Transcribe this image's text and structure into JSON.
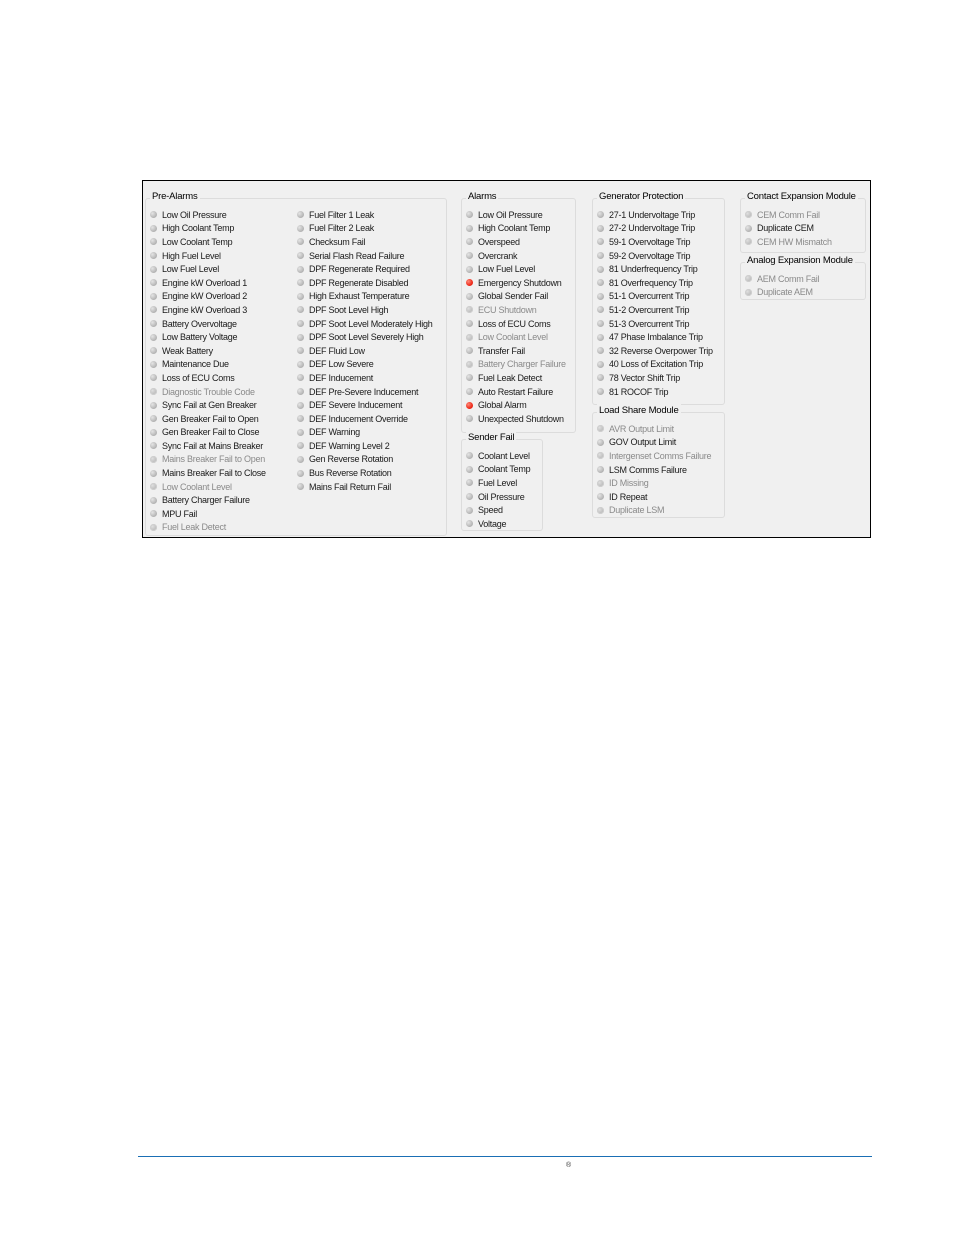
{
  "groups": {
    "pre_alarms": {
      "title": "Pre-Alarms",
      "col1": [
        {
          "label": "Low Oil Pressure",
          "state": "off",
          "enabled": true
        },
        {
          "label": "High Coolant Temp",
          "state": "off",
          "enabled": true
        },
        {
          "label": "Low Coolant Temp",
          "state": "off",
          "enabled": true
        },
        {
          "label": "High Fuel Level",
          "state": "off",
          "enabled": true
        },
        {
          "label": "Low Fuel Level",
          "state": "off",
          "enabled": true
        },
        {
          "label": "Engine kW Overload 1",
          "state": "off",
          "enabled": true
        },
        {
          "label": "Engine kW Overload 2",
          "state": "off",
          "enabled": true
        },
        {
          "label": "Engine kW Overload 3",
          "state": "off",
          "enabled": true
        },
        {
          "label": "Battery Overvoltage",
          "state": "off",
          "enabled": true
        },
        {
          "label": "Low Battery Voltage",
          "state": "off",
          "enabled": true
        },
        {
          "label": "Weak Battery",
          "state": "off",
          "enabled": true
        },
        {
          "label": "Maintenance Due",
          "state": "off",
          "enabled": true
        },
        {
          "label": "Loss of ECU Coms",
          "state": "off",
          "enabled": true
        },
        {
          "label": "Diagnostic Trouble Code",
          "state": "off",
          "enabled": false
        },
        {
          "label": "Sync Fail at Gen Breaker",
          "state": "off",
          "enabled": true
        },
        {
          "label": "Gen Breaker Fail to Open",
          "state": "off",
          "enabled": true
        },
        {
          "label": "Gen Breaker Fail to Close",
          "state": "off",
          "enabled": true
        },
        {
          "label": "Sync Fail at Mains Breaker",
          "state": "off",
          "enabled": true
        },
        {
          "label": "Mains Breaker Fail to Open",
          "state": "off",
          "enabled": false
        },
        {
          "label": "Mains Breaker Fail to Close",
          "state": "off",
          "enabled": true
        },
        {
          "label": "Low Coolant Level",
          "state": "off",
          "enabled": false
        },
        {
          "label": "Battery Charger Failure",
          "state": "off",
          "enabled": true
        },
        {
          "label": "MPU Fail",
          "state": "off",
          "enabled": true
        },
        {
          "label": "Fuel Leak Detect",
          "state": "off",
          "enabled": false
        }
      ],
      "col2": [
        {
          "label": "Fuel Filter 1 Leak",
          "state": "off",
          "enabled": true
        },
        {
          "label": "Fuel Filter 2 Leak",
          "state": "off",
          "enabled": true
        },
        {
          "label": "Checksum Fail",
          "state": "off",
          "enabled": true
        },
        {
          "label": "Serial Flash Read Failure",
          "state": "off",
          "enabled": true
        },
        {
          "label": "DPF Regenerate Required",
          "state": "off",
          "enabled": true
        },
        {
          "label": "DPF Regenerate Disabled",
          "state": "off",
          "enabled": true
        },
        {
          "label": "High Exhaust Temperature",
          "state": "off",
          "enabled": true
        },
        {
          "label": "DPF Soot Level High",
          "state": "off",
          "enabled": true
        },
        {
          "label": "DPF Soot Level Moderately High",
          "state": "off",
          "enabled": true
        },
        {
          "label": "DPF Soot Level Severely High",
          "state": "off",
          "enabled": true
        },
        {
          "label": "DEF Fluid Low",
          "state": "off",
          "enabled": true
        },
        {
          "label": "DEF Low Severe",
          "state": "off",
          "enabled": true
        },
        {
          "label": "DEF Inducement",
          "state": "off",
          "enabled": true
        },
        {
          "label": "DEF Pre-Severe Inducement",
          "state": "off",
          "enabled": true
        },
        {
          "label": "DEF Severe Inducement",
          "state": "off",
          "enabled": true
        },
        {
          "label": "DEF Inducement Override",
          "state": "off",
          "enabled": true
        },
        {
          "label": "DEF Warning",
          "state": "off",
          "enabled": true
        },
        {
          "label": "DEF Warning Level 2",
          "state": "off",
          "enabled": true
        },
        {
          "label": "Gen Reverse Rotation",
          "state": "off",
          "enabled": true
        },
        {
          "label": "Bus Reverse Rotation",
          "state": "off",
          "enabled": true
        },
        {
          "label": "Mains Fail Return Fail",
          "state": "off",
          "enabled": true
        }
      ]
    },
    "alarms": {
      "title": "Alarms",
      "items": [
        {
          "label": "Low Oil Pressure",
          "state": "off",
          "enabled": true
        },
        {
          "label": "High Coolant Temp",
          "state": "off",
          "enabled": true
        },
        {
          "label": "Overspeed",
          "state": "off",
          "enabled": true
        },
        {
          "label": "Overcrank",
          "state": "off",
          "enabled": true
        },
        {
          "label": "Low Fuel Level",
          "state": "off",
          "enabled": true
        },
        {
          "label": "Emergency Shutdown",
          "state": "on",
          "enabled": true
        },
        {
          "label": "Global Sender Fail",
          "state": "off",
          "enabled": true
        },
        {
          "label": "ECU Shutdown",
          "state": "off",
          "enabled": false
        },
        {
          "label": "Loss of ECU Coms",
          "state": "off",
          "enabled": true
        },
        {
          "label": "Low Coolant Level",
          "state": "off",
          "enabled": false
        },
        {
          "label": "Transfer Fail",
          "state": "off",
          "enabled": true
        },
        {
          "label": "Battery Charger Failure",
          "state": "off",
          "enabled": false
        },
        {
          "label": "Fuel Leak Detect",
          "state": "off",
          "enabled": true
        },
        {
          "label": "Auto Restart Failure",
          "state": "off",
          "enabled": true
        },
        {
          "label": "Global Alarm",
          "state": "on",
          "enabled": true
        },
        {
          "label": "Unexpected Shutdown",
          "state": "off",
          "enabled": true
        }
      ]
    },
    "sender_fail": {
      "title": "Sender Fail",
      "items": [
        {
          "label": "Coolant Level",
          "state": "off",
          "enabled": true
        },
        {
          "label": "Coolant Temp",
          "state": "off",
          "enabled": true
        },
        {
          "label": "Fuel Level",
          "state": "off",
          "enabled": true
        },
        {
          "label": "Oil Pressure",
          "state": "off",
          "enabled": true
        },
        {
          "label": "Speed",
          "state": "off",
          "enabled": true
        },
        {
          "label": "Voltage",
          "state": "off",
          "enabled": true
        }
      ]
    },
    "generator_protection": {
      "title": "Generator Protection",
      "items": [
        {
          "label": "27-1 Undervoltage Trip",
          "state": "off",
          "enabled": true
        },
        {
          "label": "27-2 Undervoltage Trip",
          "state": "off",
          "enabled": true
        },
        {
          "label": "59-1 Overvoltage Trip",
          "state": "off",
          "enabled": true
        },
        {
          "label": "59-2 Overvoltage Trip",
          "state": "off",
          "enabled": true
        },
        {
          "label": "81 Underfrequency Trip",
          "state": "off",
          "enabled": true
        },
        {
          "label": "81 Overfrequency Trip",
          "state": "off",
          "enabled": true
        },
        {
          "label": "51-1 Overcurrent Trip",
          "state": "off",
          "enabled": true
        },
        {
          "label": "51-2 Overcurrent Trip",
          "state": "off",
          "enabled": true
        },
        {
          "label": "51-3 Overcurrent Trip",
          "state": "off",
          "enabled": true
        },
        {
          "label": "47 Phase Imbalance Trip",
          "state": "off",
          "enabled": true
        },
        {
          "label": "32 Reverse Overpower Trip",
          "state": "off",
          "enabled": true
        },
        {
          "label": "40 Loss of Excitation Trip",
          "state": "off",
          "enabled": true
        },
        {
          "label": "78 Vector Shift Trip",
          "state": "off",
          "enabled": true
        },
        {
          "label": "81 ROCOF Trip",
          "state": "off",
          "enabled": true
        }
      ]
    },
    "load_share_module": {
      "title": "Load Share Module",
      "items": [
        {
          "label": "AVR Output Limit",
          "state": "off",
          "enabled": false
        },
        {
          "label": "GOV Output Limit",
          "state": "off",
          "enabled": true
        },
        {
          "label": "Intergenset Comms Failure",
          "state": "off",
          "enabled": false
        },
        {
          "label": "LSM Comms Failure",
          "state": "off",
          "enabled": true
        },
        {
          "label": "ID Missing",
          "state": "off",
          "enabled": false
        },
        {
          "label": "ID Repeat",
          "state": "off",
          "enabled": true
        },
        {
          "label": "Duplicate LSM",
          "state": "off",
          "enabled": false
        }
      ]
    },
    "contact_expansion_module": {
      "title": "Contact Expansion Module",
      "items": [
        {
          "label": "CEM Comm Fail",
          "state": "off",
          "enabled": false
        },
        {
          "label": "Duplicate CEM",
          "state": "off",
          "enabled": true
        },
        {
          "label": "CEM HW Mismatch",
          "state": "off",
          "enabled": false
        }
      ]
    },
    "analog_expansion_module": {
      "title": "Analog Expansion Module",
      "items": [
        {
          "label": "AEM Comm Fail",
          "state": "off",
          "enabled": false
        },
        {
          "label": "Duplicate AEM",
          "state": "off",
          "enabled": false
        }
      ]
    }
  },
  "colors": {
    "led_on": "#ee2b1b",
    "led_off": "#b2b2b2",
    "footer_rule": "#1a6fb5"
  },
  "footer": {
    "mark": "®"
  }
}
